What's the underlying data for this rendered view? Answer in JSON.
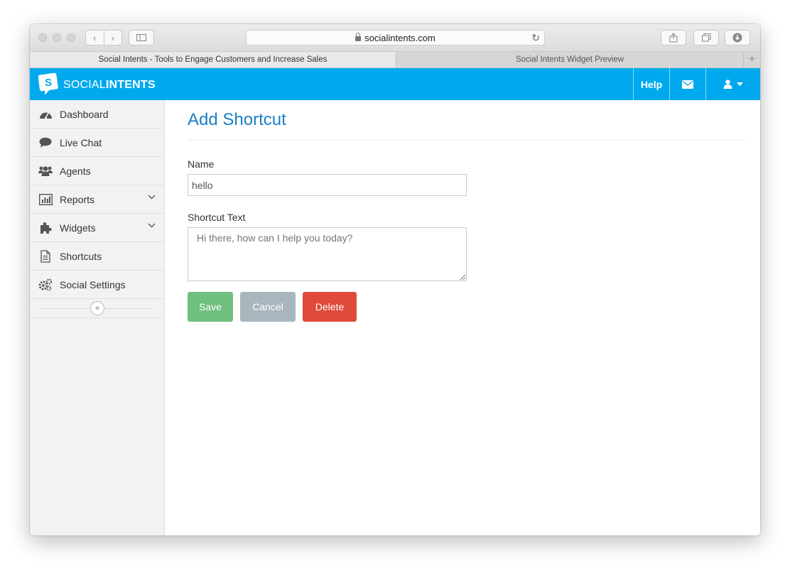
{
  "browser": {
    "url": "socialintents.com",
    "tabs": [
      {
        "label": "Social Intents - Tools to Engage Customers and Increase Sales",
        "active": true
      },
      {
        "label": "Social Intents Widget Preview",
        "active": false
      }
    ]
  },
  "header": {
    "brand_light": "SOCIAL",
    "brand_bold": "INTENTS",
    "help_label": "Help",
    "accent_color": "#00a9ee"
  },
  "sidebar": {
    "items": [
      {
        "label": "Dashboard",
        "icon": "dashboard-icon"
      },
      {
        "label": "Live Chat",
        "icon": "chat-icon"
      },
      {
        "label": "Agents",
        "icon": "users-icon"
      },
      {
        "label": "Reports",
        "icon": "bar-chart-icon",
        "expandable": true
      },
      {
        "label": "Widgets",
        "icon": "puzzle-icon",
        "expandable": true
      },
      {
        "label": "Shortcuts",
        "icon": "document-icon"
      },
      {
        "label": "Social Settings",
        "icon": "gears-icon"
      }
    ]
  },
  "main": {
    "title": "Add Shortcut",
    "name_label": "Name",
    "name_value": "hello",
    "text_label": "Shortcut Text",
    "text_placeholder": "Hi there, how can I help you today?",
    "buttons": {
      "save": "Save",
      "cancel": "Cancel",
      "delete": "Delete"
    },
    "colors": {
      "save": "#6fbf7e",
      "cancel": "#a9b6be",
      "delete": "#e04a3a",
      "title": "#1a7fc4"
    }
  }
}
